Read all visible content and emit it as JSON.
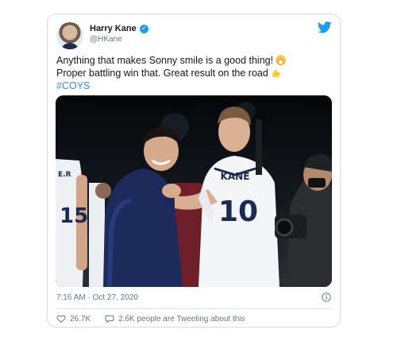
{
  "tweet": {
    "author_name": "Harry Kane",
    "handle": "@HKane",
    "text_line1": "Anything that makes Sonny smile is a good thing!",
    "text_line2": "Proper battling win that. Great result on the road",
    "hashtag": "#COYS",
    "timestamp": "7:16 AM · Oct 27, 2020",
    "likes": "26.7K",
    "conversation": "2.6K people are Tweeting about this"
  },
  "photo": {
    "jersey_name": "KANE",
    "jersey_number": "10",
    "left_jersey_number": "15",
    "left_jersey_letters": "E.R"
  },
  "icons": {
    "brand": "twitter-bird-icon",
    "verified": "verified-badge-icon",
    "info": "info-icon",
    "like": "heart-icon",
    "reply": "speech-bubble-icon"
  },
  "colors": {
    "accent": "#1d9bf0",
    "link": "#1b95e0",
    "muted": "#657786",
    "text": "#14171a",
    "border": "#cfd9de"
  }
}
